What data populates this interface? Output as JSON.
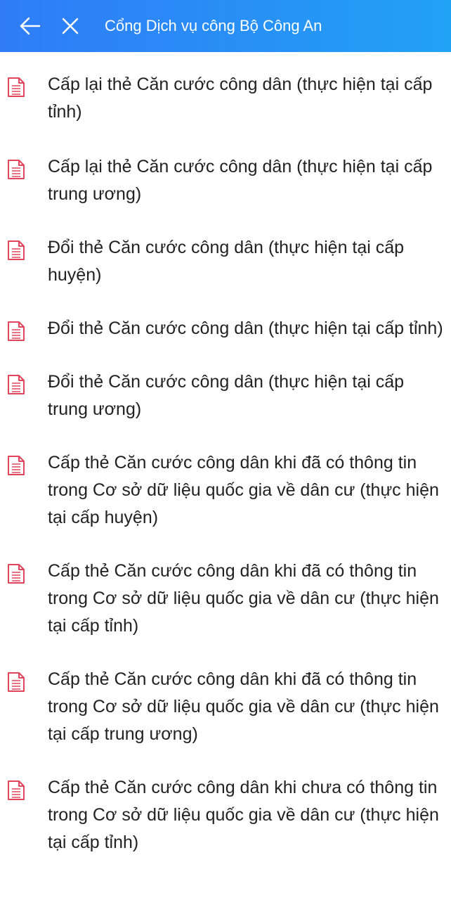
{
  "header": {
    "title": "Cổng Dịch vụ công Bộ Công An"
  },
  "icons": {
    "back": "arrow-left-icon",
    "close": "close-icon",
    "document": "document-icon"
  },
  "colors": {
    "header_start": "#2f7cf6",
    "header_end": "#21a2f5",
    "icon_accent": "#e0455c"
  },
  "procedures": [
    {
      "label": "Cấp lại thẻ Căn cước công dân (thực hiện tại cấp tỉnh)"
    },
    {
      "label": "Cấp lại thẻ Căn cước công dân (thực hiện tại cấp trung ương)"
    },
    {
      "label": "Đổi thẻ Căn cước công dân (thực hiện tại cấp huyện)"
    },
    {
      "label": "Đổi thẻ Căn cước công dân (thực hiện tại cấp tỉnh)"
    },
    {
      "label": "Đổi thẻ Căn cước công dân (thực hiện tại cấp trung ương)"
    },
    {
      "label": "Cấp thẻ Căn cước công dân khi đã có thông tin trong Cơ sở dữ liệu quốc gia về dân cư (thực hiện tại cấp huyện)"
    },
    {
      "label": "Cấp thẻ Căn cước công dân khi đã có thông tin trong Cơ sở dữ liệu quốc gia về dân cư (thực hiện tại cấp tỉnh)"
    },
    {
      "label": "Cấp thẻ Căn cước công dân khi đã có thông tin trong Cơ sở dữ liệu quốc gia về dân cư (thực hiện tại cấp trung ương)"
    },
    {
      "label": "Cấp thẻ Căn cước công dân khi chưa có thông tin trong Cơ sở dữ liệu quốc gia về dân cư (thực hiện tại cấp tỉnh)"
    }
  ]
}
